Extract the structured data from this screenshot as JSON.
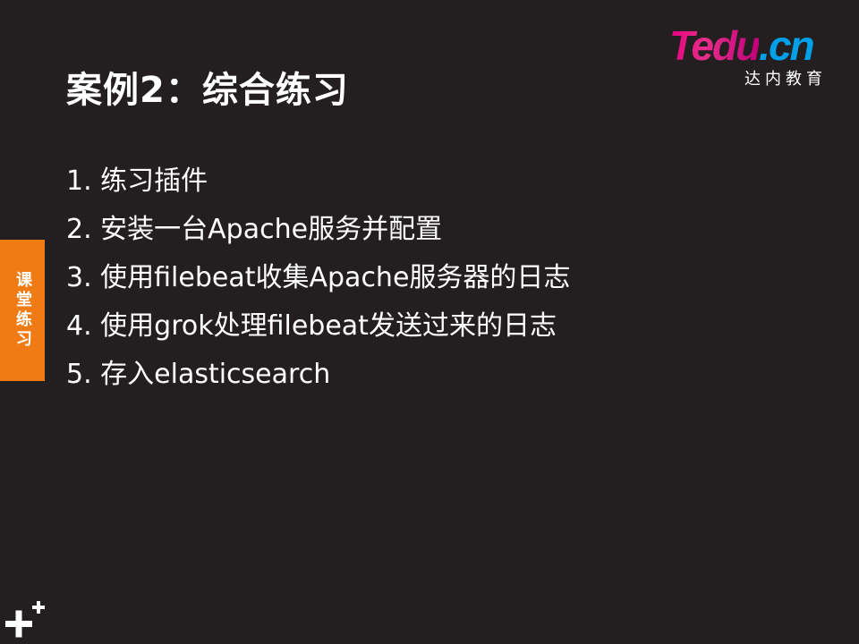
{
  "slide": {
    "title": "案例2：综合练习",
    "items": [
      "1. 练习插件",
      "2. 安装一台Apache服务并配置",
      "3. 使用filebeat收集Apache服务器的日志",
      "4. 使用grok处理filebeat发送过来的日志",
      "5. 存入elasticsearch"
    ]
  },
  "logo": {
    "word_main": "Tedu",
    "word_suffix": ".cn",
    "subtitle": "达内教育"
  },
  "side_tab": {
    "label": "课堂练习",
    "color": "#f07b14"
  },
  "corner": {
    "icon": "plus-icon"
  },
  "colors": {
    "background": "#231f20",
    "text": "#ffffff",
    "accent": "#f07b14"
  }
}
